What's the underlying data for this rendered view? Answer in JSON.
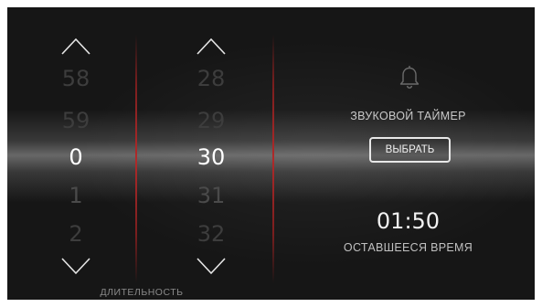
{
  "minutes_picker": {
    "values": [
      "58",
      "59",
      "0",
      "1",
      "2"
    ],
    "selected": "0"
  },
  "seconds_picker": {
    "values": [
      "28",
      "29",
      "30",
      "31",
      "32"
    ],
    "selected": "30"
  },
  "duration_label": "ДЛИТЕЛЬНОСТЬ",
  "sound_timer": {
    "icon": "bell-icon",
    "label": "ЗВУКОВОЙ ТАЙМЕР",
    "button_label": "ВЫБРАТЬ"
  },
  "remaining": {
    "time": "01:50",
    "label": "ОСТАВШЕЕСЯ ВРЕМЯ"
  },
  "colors": {
    "background": "#161616",
    "divider_accent": "#b02a2a",
    "selected_text": "#ffffff",
    "dim_text": "#3d3d3d"
  }
}
